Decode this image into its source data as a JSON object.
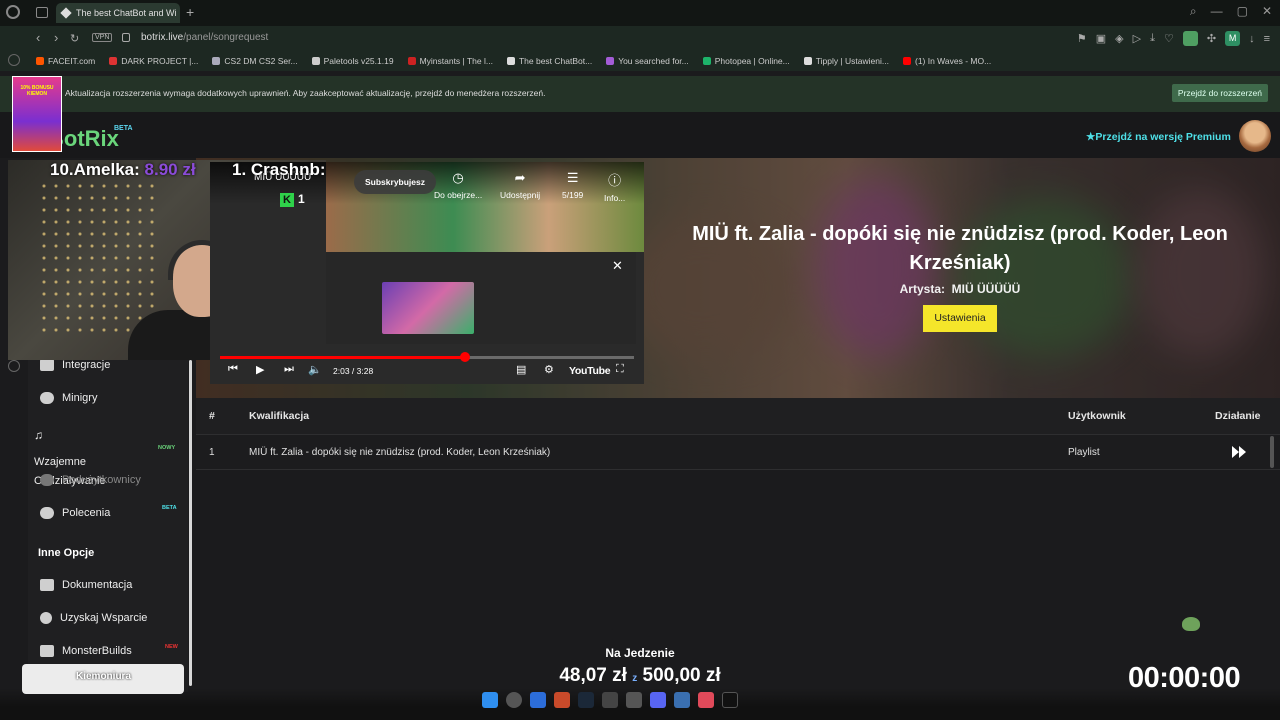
{
  "browser": {
    "active_tab": "The best ChatBot and Wi",
    "new_tab_label": "+",
    "url_host": "botrix.live",
    "url_path": "/panel/songrequest",
    "vpn_label": "VPN",
    "bookmarks": [
      {
        "label": "FACEIT.com",
        "color": "#ff5500"
      },
      {
        "label": "DARK PROJECT |...",
        "color": "#d33"
      },
      {
        "label": "CS2 DM CS2 Ser...",
        "color": "#aab"
      },
      {
        "label": "Paletools v25.1.19",
        "color": "#ccc"
      },
      {
        "label": "Myinstants | The l...",
        "color": "#c22"
      },
      {
        "label": "The best ChatBot...",
        "color": "#ddd"
      },
      {
        "label": "You searched for...",
        "color": "#a35cd6"
      },
      {
        "label": "Photopea | Online...",
        "color": "#1db46a"
      },
      {
        "label": "Tipply | Ustawieni...",
        "color": "#ddd"
      },
      {
        "label": "(1) In Waves - MO...",
        "color": "#f00"
      }
    ],
    "notice_text": "Aktualizacja rozszerzenia wymaga dodatkowych uprawnień. Aby zaakceptować aktualizację, przejdź do menedżera rozszerzeń.",
    "notice_button": "Przejdź do rozszerzeń"
  },
  "header": {
    "logo": "BotRix",
    "logo_badge": "BETA",
    "premium_link": "Przejdź na wersję Premium"
  },
  "hero": {
    "song_title": "MIÜ ft. Zalia - dopóki się nie znüdzisz (prod. Koder, Leon Krześniak)",
    "artist_label": "Artysta:",
    "artist_value": "MIÜ ÜÜÜÜÜ",
    "settings_button": "Ustawienia"
  },
  "table": {
    "headers": {
      "num": "#",
      "title": "Kwalifikacja",
      "user": "Użytkownik",
      "action": "Działanie"
    },
    "rows": [
      {
        "num": "1",
        "title": "MIÜ ft. Zalia - dopóki się nie znüdzisz (prod. Koder, Leon Krześniak)",
        "user": "Playlist"
      }
    ]
  },
  "sidebar": {
    "items": [
      {
        "label": "Integracje",
        "icon": "integrations-icon"
      },
      {
        "label": "Minigry",
        "icon": "gamepad-icon"
      },
      {
        "label": "Wzajemne Oddziaływanie",
        "icon": "music-icon",
        "badge": "NOWY"
      },
      {
        "label": "Podużytkownicy",
        "icon": "users-icon"
      },
      {
        "label": "Polecenia",
        "icon": "referral-icon",
        "badge": "BETA"
      }
    ],
    "section_title": "Inne Opcje",
    "other_items": [
      {
        "label": "Dokumentacja",
        "icon": "book-icon"
      },
      {
        "label": "Uzyskaj Wsparcie",
        "icon": "help-icon"
      },
      {
        "label": "MonsterBuilds",
        "icon": "laptop-icon",
        "badge": "NEW"
      }
    ]
  },
  "youtube": {
    "channel": "MIÜ ÜÜÜÜÜ",
    "subscribe": "Subskrybujesz",
    "actions": [
      {
        "label": "Do obejrze...",
        "icon": "clock-icon"
      },
      {
        "label": "Udostępnij",
        "icon": "share-icon"
      },
      {
        "label": "5/199",
        "icon": "playlist-icon"
      },
      {
        "label": "Info...",
        "icon": "info-icon"
      }
    ],
    "k_counter": "1",
    "time": "2:03 / 3:28",
    "progress": 0.5913,
    "logo": "YouTube"
  },
  "stream_overlay": {
    "donor_rank": "10.",
    "donor_name": "Amelka:",
    "donor_amount": "8.90 zł",
    "top_donor": "1. Crashnb:",
    "promo_text": "10% BONUSU KIEMON",
    "goal_label": "Na Jedzenie",
    "goal_current": "48,07 zł",
    "goal_sep": "z",
    "goal_target": "500,00 zł",
    "timer": "00:00:00",
    "streamer_tag": "Kiemoniura"
  },
  "colors": {
    "accent_green": "#6ad57b",
    "premium_cyan": "#4ee0e8",
    "settings_yellow": "#f5e62a",
    "yt_red": "#ff0000"
  }
}
